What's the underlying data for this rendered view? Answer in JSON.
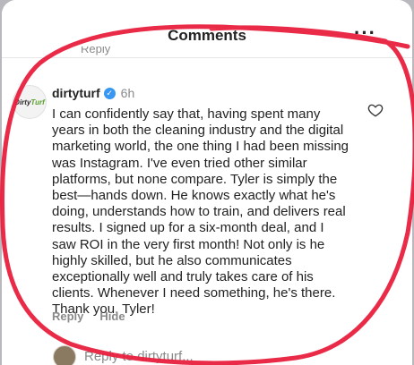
{
  "header": {
    "title": "Comments",
    "more_icon": "more-horizontal-icon"
  },
  "previous_reply": "Reply",
  "comment": {
    "username": "dirtyturf",
    "avatar_text": {
      "dirty": "Dirty",
      "turf": "Turf"
    },
    "verified_icon": "verified-badge-icon",
    "time": "6h",
    "text": "I can confidently say that, having spent many\nyears in both the cleaning industry and the digital\nmarketing world, the one thing I had been missing\nwas Instagram. I've even tried other similar\nplatforms, but none compare. Tyler is simply the\nbest—hands down. He knows exactly what he's\ndoing, understands how to train, and delivers real\nresults. I signed up for a six-month deal, and I\nsaw ROI in the very first month! Not only is he\nhighly skilled, but he also communicates\nexceptionally well and truly takes care of his\nclients. Whenever I need something, he's there.\nThank you, Tyler!",
    "actions": {
      "reply": "Reply",
      "hide": "Hide"
    }
  },
  "composer": {
    "placeholder": "Reply to dirtyturf..."
  },
  "colors": {
    "annotation": "#e8203e",
    "verified": "#3897f0"
  }
}
